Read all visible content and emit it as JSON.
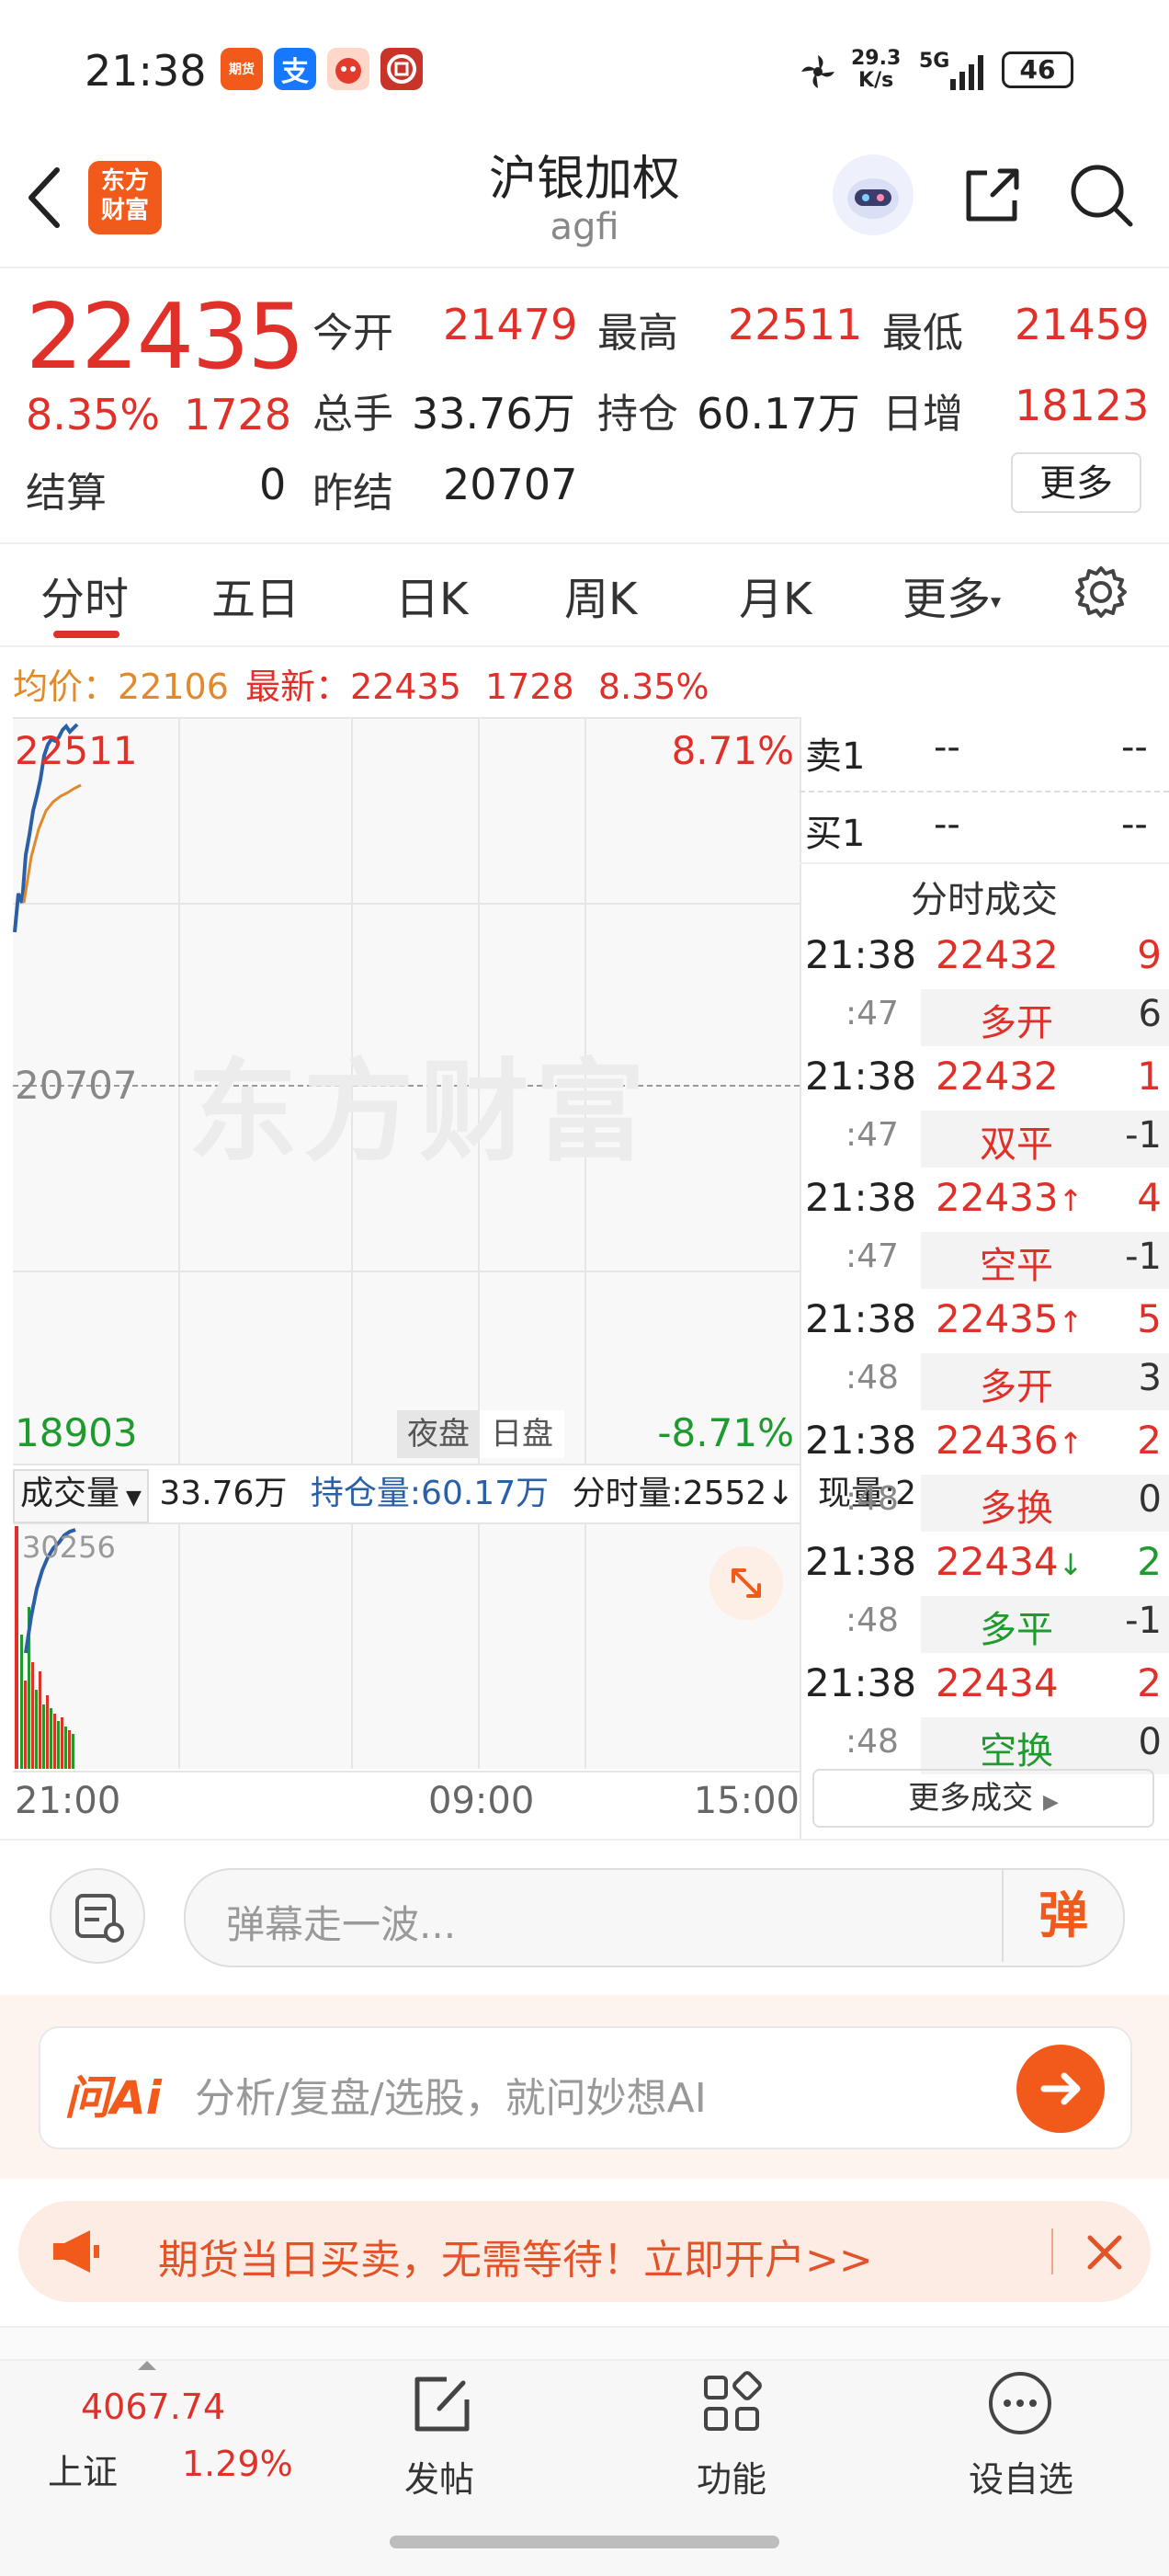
{
  "status_bar": {
    "time": "21:38",
    "apps": [
      "期货",
      "支",
      "",
      ""
    ],
    "net_speed_top": "29.3",
    "net_speed_unit": "K/s",
    "network": "5G",
    "battery": "46"
  },
  "header": {
    "logo_text": "东方财富",
    "title": "沪银加权",
    "subtitle": "agfi"
  },
  "quote": {
    "price": "22435",
    "change_pct": "8.35%",
    "change": "1728",
    "settle_label": "结算",
    "settle_value": "0",
    "open_label": "今开",
    "open_value": "21479",
    "high_label": "最高",
    "high_value": "22511",
    "low_label": "最低",
    "low_value": "21459",
    "volume_label": "总手",
    "volume_value": "33.76万",
    "oi_label": "持仓",
    "oi_value": "60.17万",
    "daily_inc_label": "日增",
    "daily_inc_value": "18123",
    "prev_settle_label": "昨结",
    "prev_settle_value": "20707",
    "more_button": "更多"
  },
  "tabs": [
    "分时",
    "五日",
    "日K",
    "周K",
    "月K",
    "更多"
  ],
  "info_line": {
    "avg_label": "均价：",
    "avg_value": "22106",
    "latest_label": "最新：",
    "latest_value": "22435",
    "latest_change": "1728",
    "latest_pct": "8.35%"
  },
  "chart": {
    "top_left": "22511",
    "top_right": "8.71%",
    "mid_label": "20707",
    "bottom_left": "18903",
    "bottom_right": "-8.71%",
    "night_btn": "夜盘",
    "day_btn": "日盘",
    "watermark": "东方财富",
    "vol_selector": "成交量",
    "vol_value": "33.76万",
    "oi_text": "持仓量:60.17万",
    "tick_vol": "分时量:2552↓",
    "now_vol": "现量:2",
    "vol_max": "30256",
    "x_labels": [
      "21:00",
      "09:00",
      "15:00"
    ]
  },
  "order_book": {
    "sell_label": "卖1",
    "sell_price": "--",
    "sell_vol": "--",
    "buy_label": "买1",
    "buy_price": "--",
    "buy_vol": "--"
  },
  "trades_title": "分时成交",
  "trades": [
    {
      "time": "21:38",
      "price": "22432",
      "arrow": "",
      "vol": "9",
      "sec": ":47",
      "type": "多开",
      "type_color": "red",
      "oi": "6"
    },
    {
      "time": "21:38",
      "price": "22432",
      "arrow": "",
      "vol": "1",
      "sec": ":47",
      "type": "双平",
      "type_color": "red",
      "oi": "-1"
    },
    {
      "time": "21:38",
      "price": "22433",
      "arrow": "↑",
      "vol": "4",
      "sec": ":47",
      "type": "空平",
      "type_color": "red",
      "oi": "-1"
    },
    {
      "time": "21:38",
      "price": "22435",
      "arrow": "↑",
      "vol": "5",
      "sec": ":48",
      "type": "多开",
      "type_color": "red",
      "oi": "3"
    },
    {
      "time": "21:38",
      "price": "22436",
      "arrow": "↑",
      "vol": "2",
      "sec": ":48",
      "type": "多换",
      "type_color": "red",
      "oi": "0"
    },
    {
      "time": "21:38",
      "price": "22434",
      "arrow": "↓",
      "vol": "2",
      "sec": ":48",
      "type": "多平",
      "type_color": "green",
      "oi": "-1"
    },
    {
      "time": "21:38",
      "price": "22434",
      "arrow": "",
      "vol": "2",
      "sec": ":48",
      "type": "空换",
      "type_color": "green",
      "oi": "0"
    }
  ],
  "more_trades": "更多成交",
  "comment": {
    "placeholder": "弹幕走一波...",
    "danmu_btn": "弹"
  },
  "ai": {
    "logo": "问Ai",
    "placeholder": "分析/复盘/选股，就问妙想AI"
  },
  "banner": {
    "text": "期货当日买卖，无需等待！立即开户>>"
  },
  "bottom_nav": {
    "index_value": "4067.74",
    "index_name": "上证",
    "index_pct": "1.29%",
    "post": "发帖",
    "functions": "功能",
    "watchlist": "设自选"
  },
  "colors": {
    "up": "#e0302a",
    "down": "#1f9a2f",
    "brand": "#f25a1c",
    "avg_line": "#e2892a",
    "price_line": "#2b5fa6"
  }
}
